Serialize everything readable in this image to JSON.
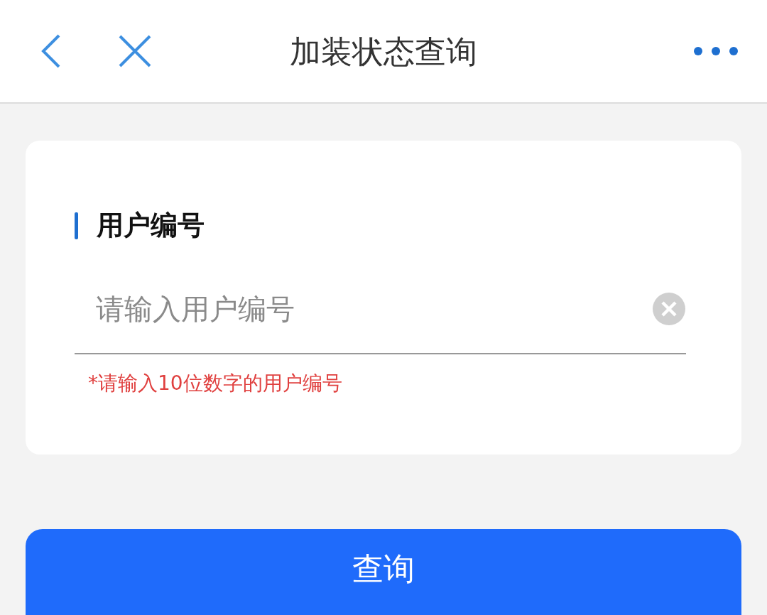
{
  "header": {
    "title": "加装状态查询"
  },
  "form": {
    "label": "用户编号",
    "field": {
      "placeholder": "请输入用户编号"
    },
    "hint": "*请输入10位数字的用户编号"
  },
  "submit": {
    "label": "查询"
  }
}
